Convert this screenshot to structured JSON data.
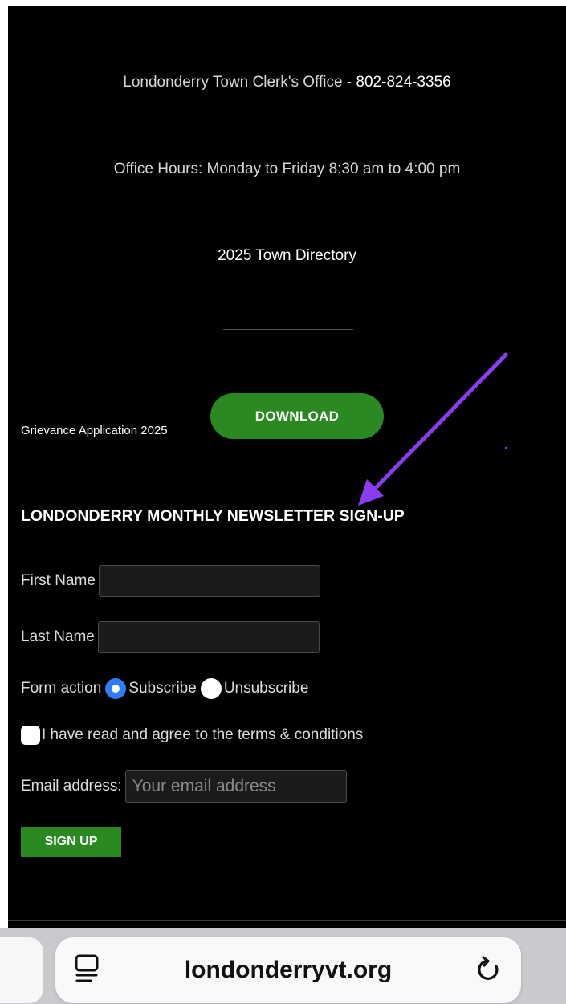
{
  "contact": {
    "clerk_label": "Londonderry Town Clerk's Office - ",
    "clerk_phone": "802-824-3356",
    "office_hours": "Office Hours: Monday to Friday 8:30 am to 4:00 pm",
    "directory_link": "2025 Town Directory"
  },
  "grievance": {
    "label": "Grievance Application 2025",
    "download_label": "DOWNLOAD"
  },
  "newsletter": {
    "heading": "LONDONDERRY MONTHLY NEWSLETTER SIGN-UP",
    "first_name_label": "First Name",
    "first_name_value": "",
    "last_name_label": "Last Name",
    "last_name_value": "",
    "form_action_label": "Form action",
    "subscribe_label": "Subscribe",
    "unsubscribe_label": "Unsubscribe",
    "selected_action": "Subscribe",
    "terms_label": "I have read and agree to the terms & conditions",
    "terms_checked": false,
    "email_label": "Email address:",
    "email_placeholder": "Your email address",
    "signup_label": "SIGN UP"
  },
  "browser": {
    "url": "londonderryvt.org",
    "reader_icon": "reader-mode-icon",
    "reload_icon": "reload-icon"
  },
  "colors": {
    "background": "#000000",
    "accent_green": "#2a8a21",
    "radio_blue": "#2e7cf6",
    "annotation_arrow": "#8a3cf0"
  }
}
